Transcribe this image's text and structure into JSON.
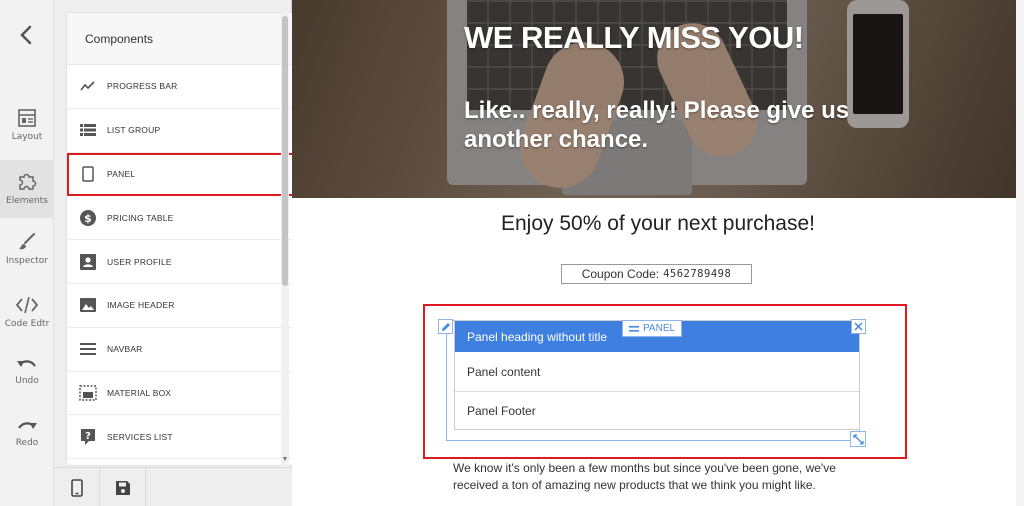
{
  "rail": {
    "items": [
      {
        "label": "Layout"
      },
      {
        "label": "Elements"
      },
      {
        "label": "Inspector"
      },
      {
        "label": "Code Edtr"
      },
      {
        "label": "Undo"
      },
      {
        "label": "Redo"
      }
    ]
  },
  "components": {
    "header": "Components",
    "items": [
      {
        "label": "PROGRESS BAR",
        "icon": "trend-line-icon"
      },
      {
        "label": "LIST GROUP",
        "icon": "list-icon"
      },
      {
        "label": "PANEL",
        "icon": "panel-icon"
      },
      {
        "label": "PRICING TABLE",
        "icon": "dollar-icon"
      },
      {
        "label": "USER PROFILE",
        "icon": "user-profile-icon"
      },
      {
        "label": "IMAGE HEADER",
        "icon": "image-icon"
      },
      {
        "label": "NAVBAR",
        "icon": "menu-icon"
      },
      {
        "label": "MATERIAL BOX",
        "icon": "material-box-icon"
      },
      {
        "label": "SERVICES LIST",
        "icon": "help-icon"
      }
    ]
  },
  "canvas": {
    "hero_title": "WE REALLY MISS YOU!",
    "hero_subtitle": "Like.. really, really! Please give us another chance.",
    "promo": "Enjoy 50% of your next purchase!",
    "coupon_label": "Coupon Code:",
    "coupon_code": "4562789498",
    "panel": {
      "heading": "Panel heading without title",
      "content": "Panel content",
      "footer": "Panel Footer",
      "tag": "PANEL"
    },
    "paragraph": "We know it's only been a few months but since you've been gone, we've received a ton of amazing new products that we think you might like."
  },
  "colors": {
    "accent": "#3e7fe0",
    "selection": "#e0191f"
  }
}
